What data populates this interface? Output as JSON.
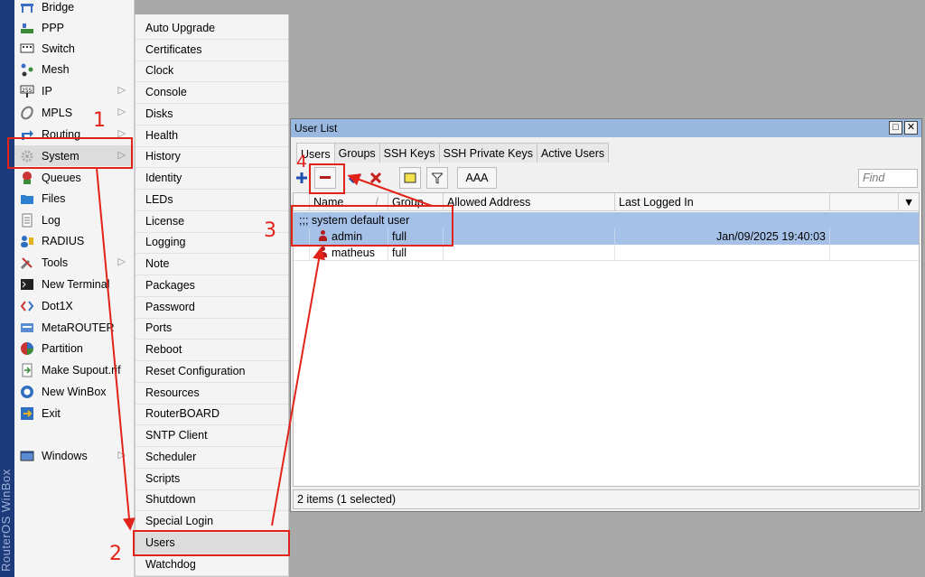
{
  "brand": "RouterOS WinBox",
  "main_menu": [
    {
      "label": "Bridge",
      "icon": "bridge-icon",
      "arrow": false
    },
    {
      "label": "PPP",
      "icon": "ppp-icon",
      "arrow": false
    },
    {
      "label": "Switch",
      "icon": "switch-icon",
      "arrow": false
    },
    {
      "label": "Mesh",
      "icon": "mesh-icon",
      "arrow": false
    },
    {
      "label": "IP",
      "icon": "ip-icon",
      "arrow": true
    },
    {
      "label": "MPLS",
      "icon": "mpls-icon",
      "arrow": true
    },
    {
      "label": "Routing",
      "icon": "routing-icon",
      "arrow": true
    },
    {
      "label": "System",
      "icon": "gear-icon",
      "arrow": true,
      "selected": true
    },
    {
      "label": "Queues",
      "icon": "queues-icon",
      "arrow": false
    },
    {
      "label": "Files",
      "icon": "folder-icon",
      "arrow": false
    },
    {
      "label": "Log",
      "icon": "log-icon",
      "arrow": false
    },
    {
      "label": "RADIUS",
      "icon": "radius-icon",
      "arrow": false
    },
    {
      "label": "Tools",
      "icon": "tools-icon",
      "arrow": true
    },
    {
      "label": "New Terminal",
      "icon": "terminal-icon",
      "arrow": false
    },
    {
      "label": "Dot1X",
      "icon": "dot1x-icon",
      "arrow": false
    },
    {
      "label": "MetaROUTER",
      "icon": "metarouter-icon",
      "arrow": false
    },
    {
      "label": "Partition",
      "icon": "partition-icon",
      "arrow": false
    },
    {
      "label": "Make Supout.rif",
      "icon": "supout-icon",
      "arrow": false
    },
    {
      "label": "New WinBox",
      "icon": "winbox-icon",
      "arrow": false
    },
    {
      "label": "Exit",
      "icon": "exit-icon",
      "arrow": false
    },
    {
      "label": "Windows",
      "icon": "windows-icon",
      "arrow": true
    }
  ],
  "system_submenu": [
    "Auto Upgrade",
    "Certificates",
    "Clock",
    "Console",
    "Disks",
    "Health",
    "History",
    "Identity",
    "LEDs",
    "License",
    "Logging",
    "Note",
    "Packages",
    "Password",
    "Ports",
    "Reboot",
    "Reset Configuration",
    "Resources",
    "RouterBOARD",
    "SNTP Client",
    "Scheduler",
    "Scripts",
    "Shutdown",
    "Special Login",
    "Users",
    "Watchdog"
  ],
  "system_submenu_selected": "Users",
  "window": {
    "title": "User List",
    "tabs": [
      "Users",
      "Groups",
      "SSH Keys",
      "SSH Private Keys",
      "Active Users"
    ],
    "active_tab": "Users",
    "toolbar": {
      "aaa_label": "AAA"
    },
    "find_placeholder": "Find",
    "columns": [
      "Name",
      "Group",
      "Allowed Address",
      "Last Logged In"
    ],
    "comment_row": ";;; system default user",
    "rows": [
      {
        "name": "admin",
        "group": "full",
        "allowed_address": "",
        "last_logged_in": "Jan/09/2025 19:40:03",
        "selected": true
      },
      {
        "name": "matheus",
        "group": "full",
        "allowed_address": "",
        "last_logged_in": "",
        "selected": false
      }
    ],
    "status": "2 items (1 selected)"
  },
  "annotations": [
    "1",
    "2",
    "3",
    "4"
  ],
  "colors": {
    "accent": "#e2231a",
    "title_bar": "#99b8e0",
    "selected_row": "#a6c1e8",
    "brand_strip": "#1d3b7a"
  }
}
